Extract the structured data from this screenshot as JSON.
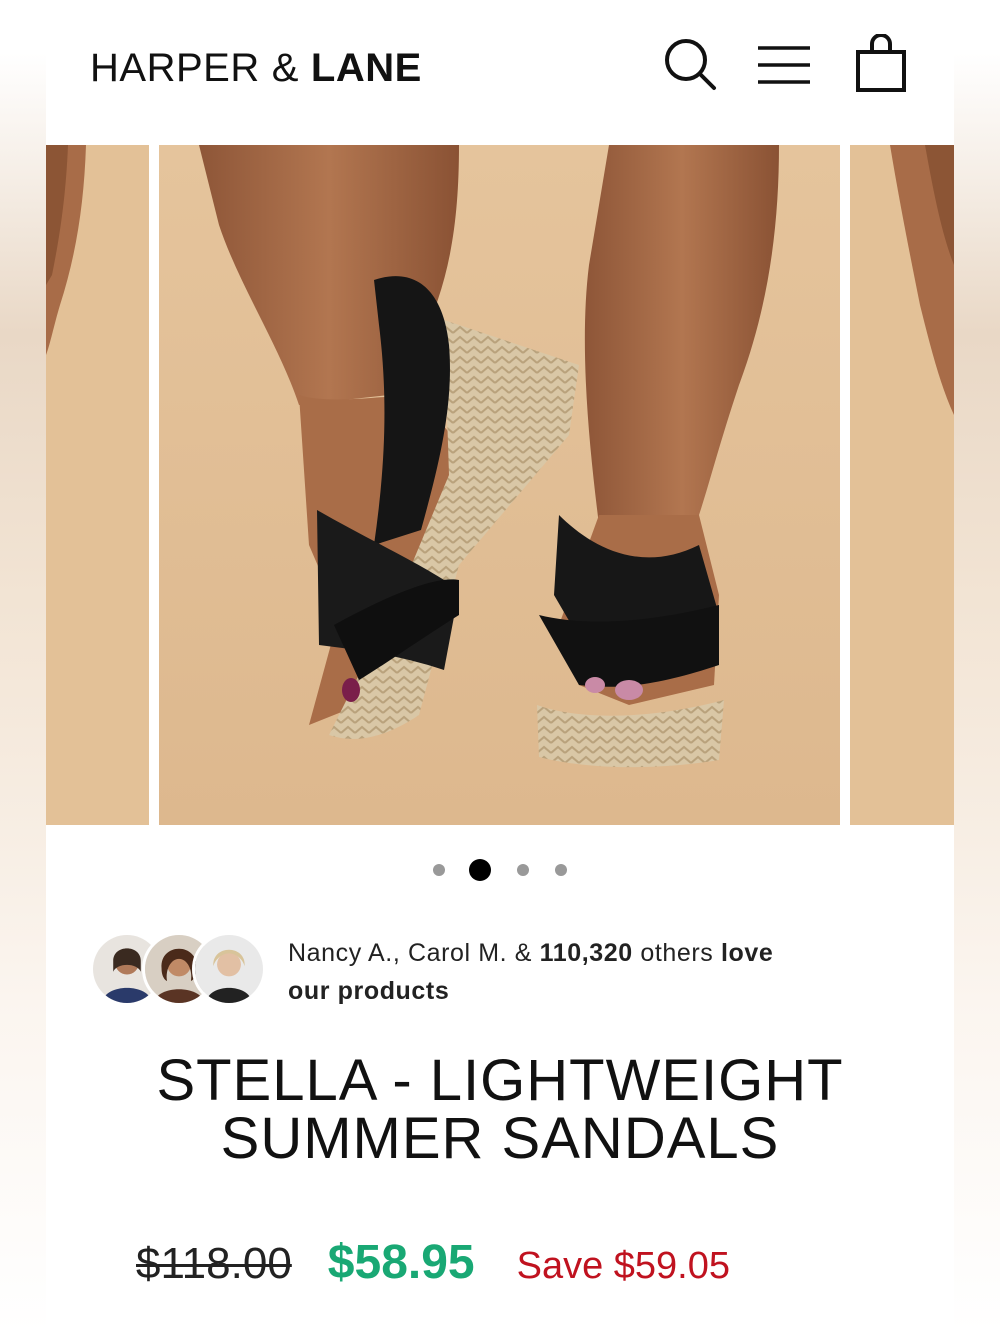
{
  "brand": {
    "part1": "HARPER",
    "amp": "&",
    "part2": "LANE"
  },
  "header_icons": [
    "search-icon",
    "menu-icon",
    "cart-icon"
  ],
  "carousel": {
    "slides": 4,
    "active_index": 1
  },
  "social_proof": {
    "names": "Nancy A., Carol M. &",
    "count": "110,320",
    "others": "others",
    "love": "love",
    "tail": "our products"
  },
  "product": {
    "title_line1": "STELLA - LIGHTWEIGHT",
    "title_line2": "SUMMER SANDALS",
    "original_price": "$118.00",
    "sale_price": "$58.95",
    "savings": "Save $59.05"
  },
  "colors": {
    "sale": "#19a874",
    "savings": "#c0121f",
    "background": "#e2bf95"
  }
}
